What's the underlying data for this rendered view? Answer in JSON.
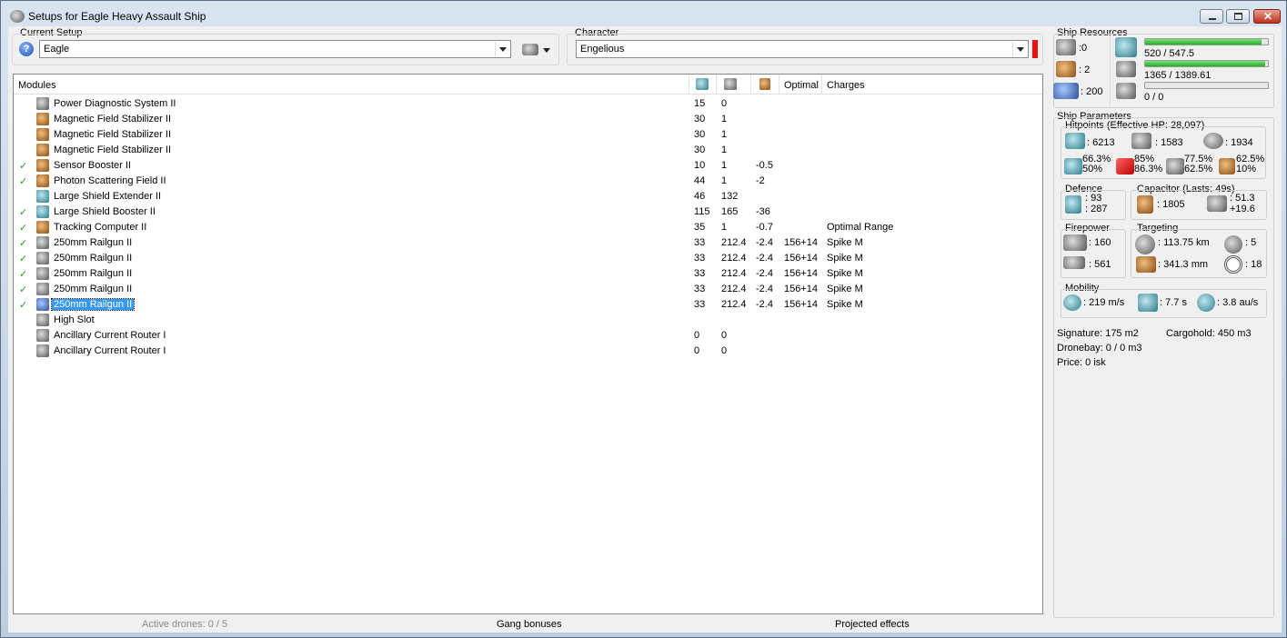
{
  "window": {
    "title": "Setups for Eagle Heavy Assault Ship"
  },
  "setup": {
    "label": "Current Setup",
    "value": "Eagle"
  },
  "character": {
    "label": "Character",
    "value": "Engelious",
    "status_color": "#ff0000"
  },
  "modules": {
    "headers": {
      "name": "Modules",
      "optimal": "Optimal",
      "charges": "Charges"
    },
    "rows": [
      {
        "check": "",
        "icon": "gi",
        "name": "Power Diagnostic System II",
        "cpu": "15",
        "pg": "0",
        "cap": "",
        "optimal": "",
        "charges": ""
      },
      {
        "check": "",
        "icon": "oi",
        "name": "Magnetic Field Stabilizer II",
        "cpu": "30",
        "pg": "1",
        "cap": "",
        "optimal": "",
        "charges": ""
      },
      {
        "check": "",
        "icon": "oi",
        "name": "Magnetic Field Stabilizer II",
        "cpu": "30",
        "pg": "1",
        "cap": "",
        "optimal": "",
        "charges": ""
      },
      {
        "check": "",
        "icon": "oi",
        "name": "Magnetic Field Stabilizer II",
        "cpu": "30",
        "pg": "1",
        "cap": "",
        "optimal": "",
        "charges": ""
      },
      {
        "check": "✓",
        "icon": "oi",
        "name": "Sensor Booster II",
        "cpu": "10",
        "pg": "1",
        "cap": "-0.5",
        "optimal": "",
        "charges": ""
      },
      {
        "check": "✓",
        "icon": "oi",
        "name": "Photon Scattering Field II",
        "cpu": "44",
        "pg": "1",
        "cap": "-2",
        "optimal": "",
        "charges": ""
      },
      {
        "check": "",
        "icon": "ci",
        "name": "Large Shield Extender II",
        "cpu": "46",
        "pg": "132",
        "cap": "",
        "optimal": "",
        "charges": ""
      },
      {
        "check": "✓",
        "icon": "ci",
        "name": "Large Shield Booster II",
        "cpu": "115",
        "pg": "165",
        "cap": "-36",
        "optimal": "",
        "charges": ""
      },
      {
        "check": "✓",
        "icon": "oi",
        "name": "Tracking Computer II",
        "cpu": "35",
        "pg": "1",
        "cap": "-0.7",
        "optimal": "",
        "charges": "Optimal Range"
      },
      {
        "check": "✓",
        "icon": "gi",
        "name": "250mm Railgun II",
        "cpu": "33",
        "pg": "212.4",
        "cap": "-2.4",
        "optimal": "156+14",
        "charges": "Spike M"
      },
      {
        "check": "✓",
        "icon": "gi",
        "name": "250mm Railgun II",
        "cpu": "33",
        "pg": "212.4",
        "cap": "-2.4",
        "optimal": "156+14",
        "charges": "Spike M"
      },
      {
        "check": "✓",
        "icon": "gi",
        "name": "250mm Railgun II",
        "cpu": "33",
        "pg": "212.4",
        "cap": "-2.4",
        "optimal": "156+14",
        "charges": "Spike M"
      },
      {
        "check": "✓",
        "icon": "gi",
        "name": "250mm Railgun II",
        "cpu": "33",
        "pg": "212.4",
        "cap": "-2.4",
        "optimal": "156+14",
        "charges": "Spike M"
      },
      {
        "check": "✓",
        "icon": "bi",
        "name": "250mm Railgun II",
        "cpu": "33",
        "pg": "212.4",
        "cap": "-2.4",
        "optimal": "156+14",
        "charges": "Spike M"
      },
      {
        "check": "",
        "icon": "gi",
        "name": "High Slot",
        "cpu": "",
        "pg": "",
        "cap": "",
        "optimal": "",
        "charges": ""
      },
      {
        "check": "",
        "icon": "gi",
        "name": "Ancillary Current Router I",
        "cpu": "0",
        "pg": "0",
        "cap": "",
        "optimal": "",
        "charges": ""
      },
      {
        "check": "",
        "icon": "gi",
        "name": "Ancillary Current Router I",
        "cpu": "0",
        "pg": "0",
        "cap": "",
        "optimal": "",
        "charges": ""
      }
    ]
  },
  "status": {
    "drones": "Active drones: 0 / 5",
    "gang": "Gang bonuses",
    "projected": "Projected effects"
  },
  "resources": {
    "title": "Ship Resources",
    "hardpoints": [
      ":0",
      ": 2",
      ": 200"
    ],
    "cpu": {
      "text": "520 / 547.5",
      "fraction": 0.95
    },
    "pg": {
      "text": "1365 / 1389.61",
      "fraction": 0.98
    },
    "calib": {
      "text": "0 / 0",
      "fraction": 0
    }
  },
  "params": {
    "title": "Ship Parameters",
    "hp_title": "Hitpoints (Effective HP: 28,097)",
    "hp": [
      ": 6213",
      ": 1583",
      ": 1934"
    ],
    "resists": [
      [
        "66.3%",
        "50%"
      ],
      [
        "85%",
        "86.3%"
      ],
      [
        "77.5%",
        "62.5%"
      ],
      [
        "62.5%",
        "10%"
      ]
    ],
    "defence": {
      "title": "Defence",
      "a": ": 93",
      "b": ": 287"
    },
    "capacitor": {
      "title": "Capacitor (Lasts: 49s)",
      "size": ": 1805",
      "rate_a": ": 51.3",
      "rate_b": "+19.6"
    },
    "firepower": {
      "title": "Firepower",
      "a": ": 160",
      "b": ": 561"
    },
    "targeting": {
      "title": "Targeting",
      "range": ": 113.75 km",
      "targets": ": 5",
      "scan": ": 341.3 mm",
      "sensor": ": 18"
    },
    "mobility": {
      "title": "Mobility",
      "speed": ": 219 m/s",
      "align": ": 7.7 s",
      "warp": ": 3.8 au/s"
    },
    "signature": "Signature: 175 m2",
    "cargo": "Cargohold: 450 m3",
    "drone": "Dronebay: 0 / 0 m3",
    "price": "Price: 0 isk"
  }
}
